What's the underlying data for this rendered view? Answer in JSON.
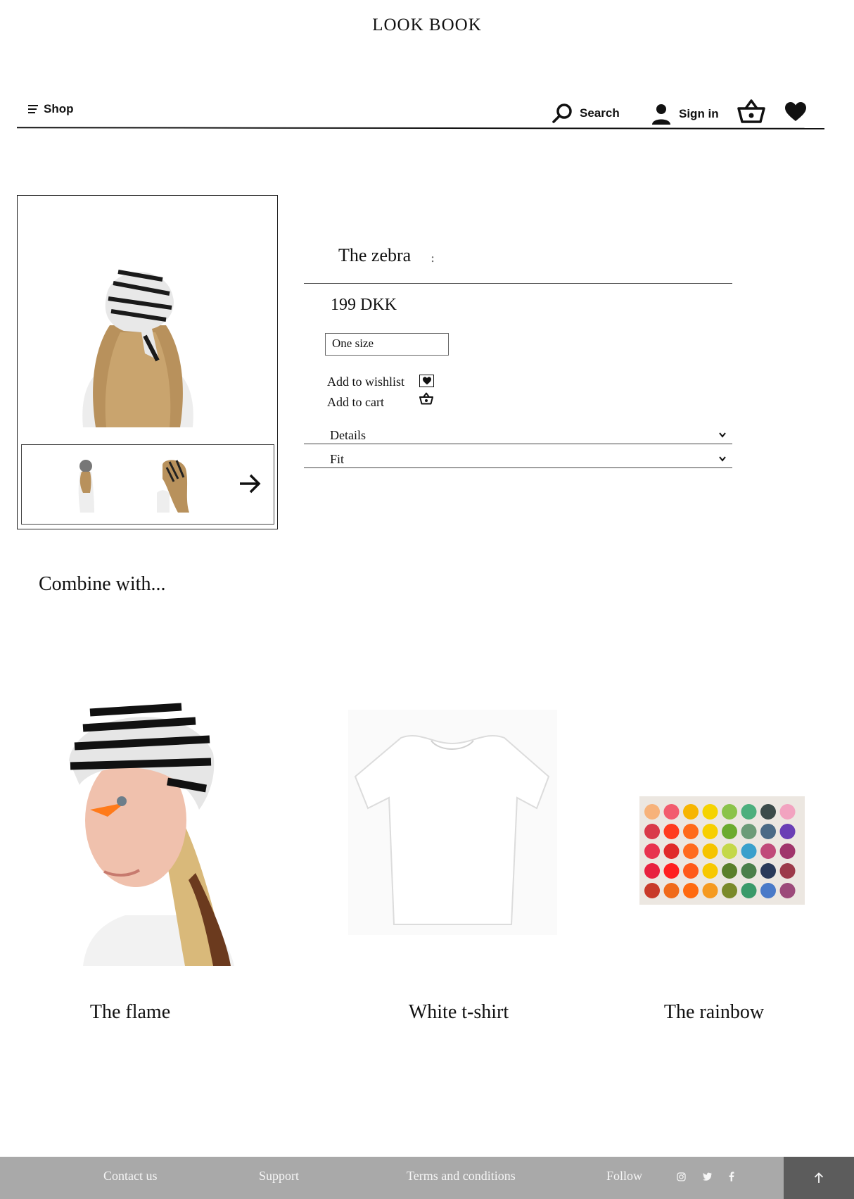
{
  "header": {
    "brand": "LOOK BOOK",
    "shop_label": "Shop",
    "search_label": "Search",
    "signin_label": "Sign in"
  },
  "product": {
    "title": "The zebra",
    "title_separator": ":",
    "price": "199 DKK",
    "size_value": "One size",
    "add_to_wishlist_label": "Add to wishlist",
    "add_to_cart_label": "Add to cart",
    "accordions": [
      {
        "label": "Details"
      },
      {
        "label": "Fit"
      }
    ]
  },
  "combine": {
    "title": "Combine with...",
    "items": [
      {
        "name": "The flame"
      },
      {
        "name": "White t-shirt"
      },
      {
        "name": "The rainbow"
      }
    ]
  },
  "footer": {
    "contact_label": "Contact us",
    "support_label": "Support",
    "terms_label": "Terms and conditions",
    "follow_label": "Follow",
    "back_to_top_color": "#5c5c5c",
    "footer_color": "#a9a9a9"
  },
  "icons": [
    "menu-icon",
    "search-icon",
    "user-icon",
    "basket-icon",
    "heart-icon",
    "arrow-right-icon",
    "chevron-down-icon",
    "instagram-icon",
    "twitter-icon",
    "facebook-icon",
    "arrow-up-icon"
  ]
}
